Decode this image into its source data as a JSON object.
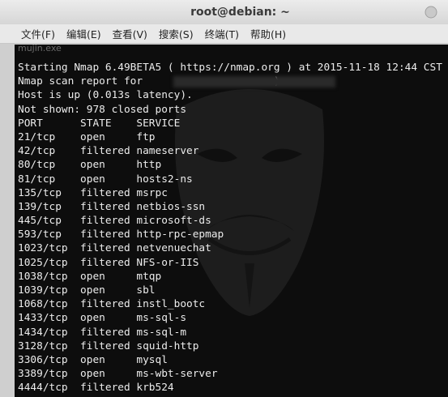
{
  "window": {
    "title": "root@debian: ~"
  },
  "menu": [
    {
      "label": "文件(F)"
    },
    {
      "label": "编辑(E)"
    },
    {
      "label": "查看(V)"
    },
    {
      "label": "搜索(S)"
    },
    {
      "label": "终端(T)"
    },
    {
      "label": "帮助(H)"
    }
  ],
  "overlay_text": "mujin.exe",
  "terminal": {
    "lines": [
      "Starting Nmap 6.49BETA5 ( https://nmap.org ) at 2015-11-18 12:44 CST",
      "Nmap scan report for                     )",
      "Host is up (0.013s latency).",
      "Not shown: 978 closed ports",
      "PORT      STATE    SERVICE",
      "21/tcp    open     ftp",
      "42/tcp    filtered nameserver",
      "80/tcp    open     http",
      "81/tcp    open     hosts2-ns",
      "135/tcp   filtered msrpc",
      "139/tcp   filtered netbios-ssn",
      "445/tcp   filtered microsoft-ds",
      "593/tcp   filtered http-rpc-epmap",
      "1023/tcp  filtered netvenuechat",
      "1025/tcp  filtered NFS-or-IIS",
      "1038/tcp  open     mtqp",
      "1039/tcp  open     sbl",
      "1068/tcp  filtered instl_bootc",
      "1433/tcp  open     ms-sql-s",
      "1434/tcp  filtered ms-sql-m",
      "3128/tcp  filtered squid-http",
      "3306/tcp  open     mysql",
      "3389/tcp  open     ms-wbt-server",
      "4444/tcp  filtered krb524"
    ]
  },
  "colors": {
    "terminal_bg": "#0d0d0d",
    "terminal_fg": "#ececec",
    "titlebar_bg": "#e0e0e0"
  },
  "icons": {
    "background": "guy-fawkes-mask-icon"
  }
}
